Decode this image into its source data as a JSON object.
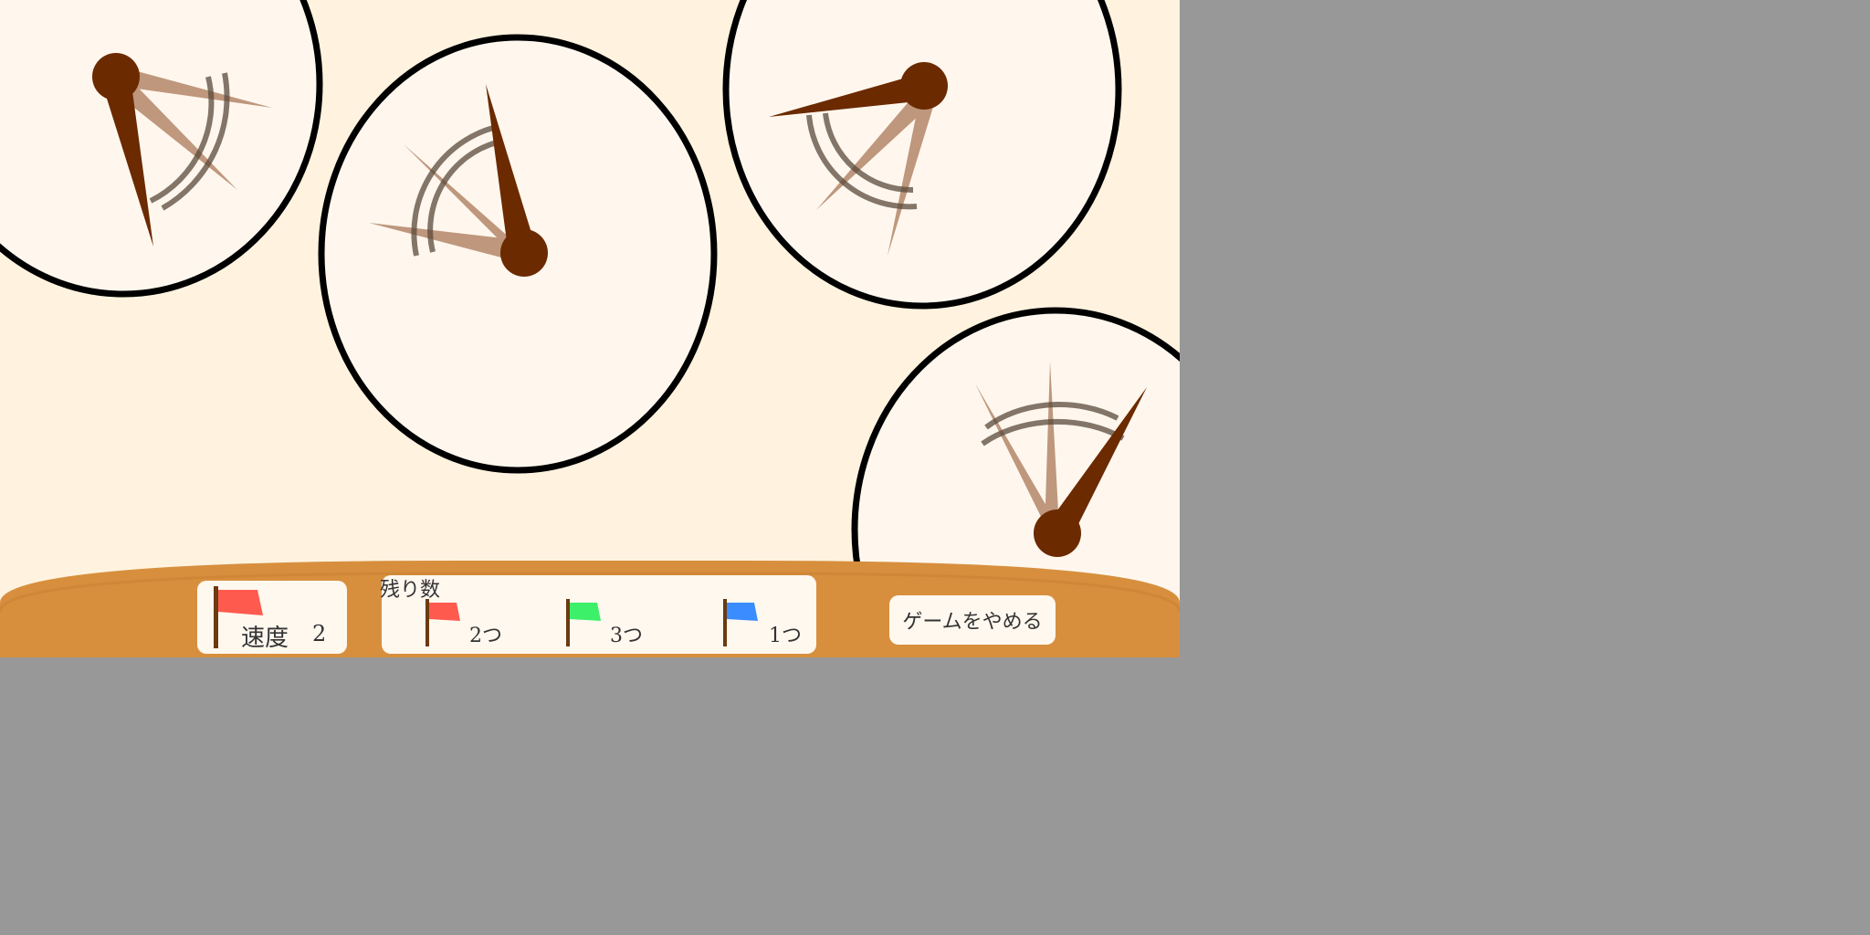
{
  "hud": {
    "speed_label": "速度",
    "speed_value": "2",
    "speed_flag_color": "#ff5a4e",
    "remaining_label": "残り数",
    "flags": [
      {
        "color": "red",
        "hex": "#ff5a4e",
        "count_label": "2つ"
      },
      {
        "color": "green",
        "hex": "#3cf06a",
        "count_label": "3つ"
      },
      {
        "color": "blue",
        "hex": "#3b8cff",
        "count_label": "1つ"
      }
    ],
    "quit_label": "ゲームをやめる"
  },
  "colors": {
    "background": "#fff3df",
    "dial_face": "#fff7ee",
    "dial_border": "#000000",
    "hand": "#6b2a00",
    "hud_bar": "#d78f3e",
    "outside": "#989898"
  }
}
